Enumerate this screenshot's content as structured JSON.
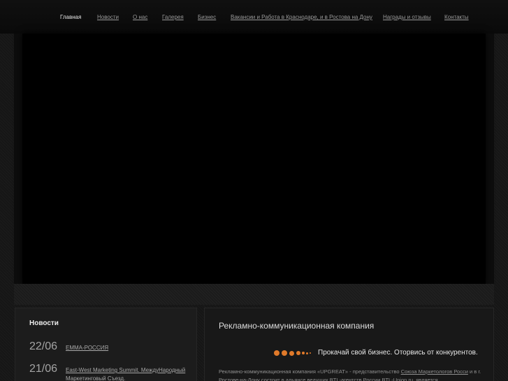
{
  "nav": {
    "items": [
      {
        "label": "Главная",
        "active": true
      },
      {
        "label": "Новости",
        "active": false
      },
      {
        "label": "О нас",
        "active": false
      },
      {
        "label": "Галерея",
        "active": false
      },
      {
        "label": "Бизнес",
        "active": false
      },
      {
        "label": "Вакансии и Работа в Краснодаре, и в Ростова на Дону",
        "active": false
      },
      {
        "label": "Награды и отзывы",
        "active": false
      },
      {
        "label": "Контакты",
        "active": false
      }
    ]
  },
  "news": {
    "title": "Новости",
    "items": [
      {
        "date": "22/06",
        "text": "ЕММА-РОССИЯ"
      },
      {
        "date": "21/06",
        "text": "East-West Marketing Summit. МеждуНародный Маркетинговый Съезд."
      }
    ]
  },
  "content": {
    "heading": "Рекламно-коммуникационная компания",
    "slogan": "Прокачай свой бизнес. Оторвись от конкурентов.",
    "accent_color": "#e07a2a",
    "paragraph": {
      "part1": "Рекламно-коммуникационная компания «UPGREAT» - представительство ",
      "link1": "Союза Маркетологов Росси",
      "part2": " и в г. Ростове-на-Дону состоит в альянсе ведущих BTL-агентств России BTL-Union.ru, является"
    }
  }
}
